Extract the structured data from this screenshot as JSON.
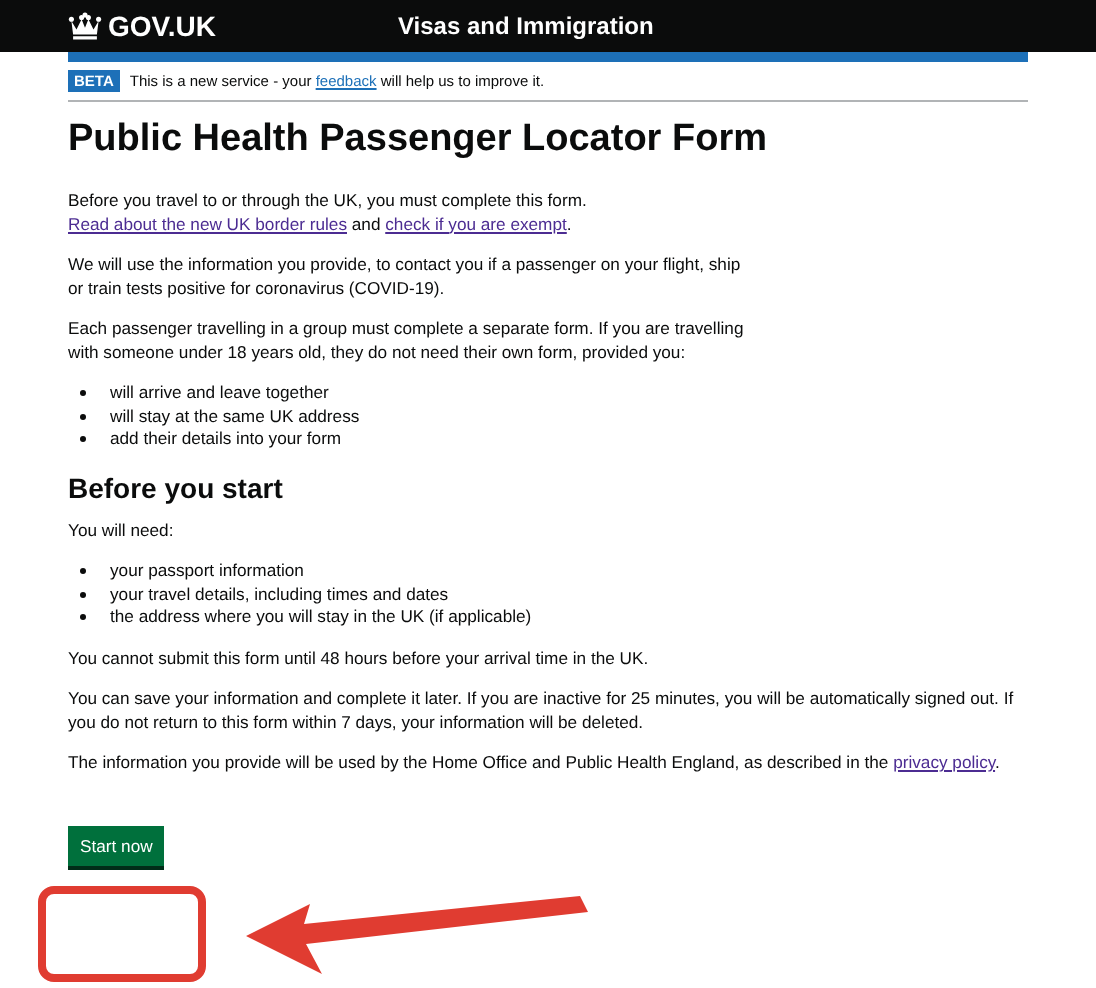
{
  "header": {
    "logo": "GOV.UK",
    "service": "Visas and Immigration"
  },
  "phase_banner": {
    "tag": "BETA",
    "text": [
      {
        "text": "This is a new service - your "
      },
      {
        "link": "feedback"
      },
      {
        "text": " will help us to improve it."
      }
    ]
  },
  "title": "Public Health Passenger Locator Form",
  "intro": [
    {
      "kind": "paragraph",
      "parts": [
        {
          "text": "Before you travel to or through the UK, you must complete this form. "
        },
        {
          "link": "Read about the new UK border rules"
        },
        {
          "text": " and "
        },
        {
          "link": "check if you are exempt"
        },
        {
          "text": "."
        }
      ]
    },
    {
      "kind": "paragraph",
      "parts": [
        {
          "text": "We will use the information you provide, to contact you if a passenger on your flight, ship or train tests positive for coronavirus (COVID-19)."
        }
      ]
    },
    {
      "kind": "paragraph",
      "parts": [
        {
          "text": "Each passenger travelling in a group must complete a separate form.  If you are travelling with someone under 18 years old, they do not need their own form, provided you:"
        }
      ]
    },
    {
      "kind": "list",
      "items": [
        "will arrive and leave together",
        "will stay at the same UK address",
        "add their details into your form"
      ]
    }
  ],
  "section": {
    "heading": "Before you start",
    "content": [
      {
        "kind": "paragraph",
        "parts": [
          {
            "text": "You will need:"
          }
        ]
      },
      {
        "kind": "list",
        "items": [
          "your passport information",
          "your travel details, including times and dates",
          "the address where you will stay in the UK (if applicable)"
        ]
      },
      {
        "kind": "paragraph",
        "parts": [
          {
            "text": "You cannot submit this form until 48 hours before your arrival time in the UK."
          }
        ]
      },
      {
        "kind": "paragraph",
        "parts": [
          {
            "text": "You can save your information and complete it later. If you are inactive for 25 minutes, you will be automatically signed out. If you do not return to this form within 7 days, your information will be deleted."
          }
        ]
      },
      {
        "kind": "paragraph",
        "parts": [
          {
            "text": "The information you provide will be used by the Home Office and Public Health England, as described in the "
          },
          {
            "link": "privacy policy"
          },
          {
            "text": "."
          }
        ]
      }
    ]
  },
  "start_button": "Start now"
}
